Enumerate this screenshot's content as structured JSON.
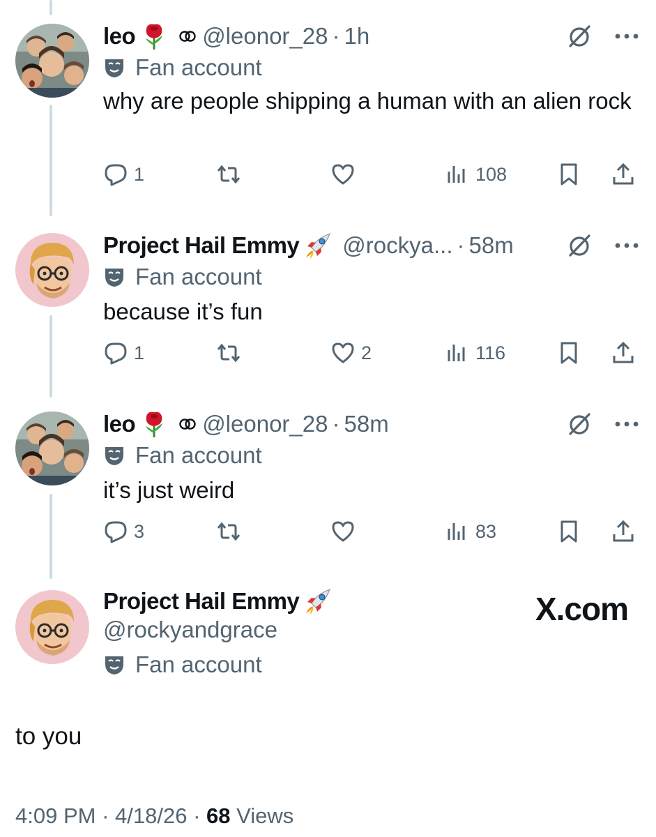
{
  "tweets": [
    {
      "name": "leo",
      "handle": "@leonor_28",
      "time": "1h",
      "badge": "Fan account",
      "text": "why are people shipping a human with an alien rock",
      "replies": "1",
      "retweets": "",
      "likes": "",
      "views": "108"
    },
    {
      "name": "Project Hail Emmy",
      "handle": "@rockya...",
      "time": "58m",
      "badge": "Fan account",
      "text": "because it’s fun",
      "replies": "1",
      "retweets": "",
      "likes": "2",
      "views": "116"
    },
    {
      "name": "leo",
      "handle": "@leonor_28",
      "time": "58m",
      "badge": "Fan account",
      "text": "it’s just weird",
      "replies": "3",
      "retweets": "",
      "likes": "",
      "views": "83"
    }
  ],
  "main": {
    "name": "Project Hail Emmy",
    "handle": "@rockyandgrace",
    "badge": "Fan account",
    "text": "to you",
    "time": "4:09 PM",
    "date": "4/18/26",
    "views_count": "68",
    "views_label": "Views",
    "watermark": "X.com"
  },
  "separator": "·",
  "colors": {
    "secondary_text": "#536471",
    "primary_text": "#0f1419",
    "thread_line": "#cfd9de"
  },
  "icons": [
    "reply-icon",
    "retweet-icon",
    "like-icon",
    "views-icon",
    "bookmark-icon",
    "share-icon",
    "grok-icon",
    "more-icon",
    "fan-mask-icon",
    "rose-emoji",
    "rocket-emoji"
  ]
}
